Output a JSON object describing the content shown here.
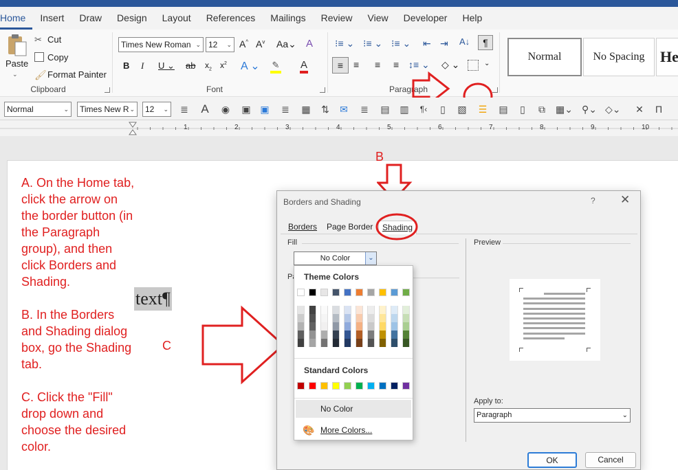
{
  "ribbon": {
    "tabs": [
      "Home",
      "Insert",
      "Draw",
      "Design",
      "Layout",
      "References",
      "Mailings",
      "Review",
      "View",
      "Developer",
      "Help"
    ],
    "active_tab": "Home",
    "clipboard": {
      "paste": "Paste",
      "cut": "Cut",
      "copy": "Copy",
      "format_painter": "Format Painter",
      "label": "Clipboard"
    },
    "font": {
      "name": "Times New Roman",
      "size": "12",
      "label": "Font"
    },
    "paragraph": {
      "label": "Paragraph"
    },
    "styles": {
      "normal": "Normal",
      "no_spacing": "No Spacing",
      "heading": "He"
    }
  },
  "qat": {
    "style": "Normal",
    "font": "Times New R",
    "size": "12"
  },
  "ruler": {
    "numbers": [
      "1",
      "2",
      "3",
      "4",
      "5",
      "6",
      "7",
      "8",
      "9",
      "10"
    ]
  },
  "document": {
    "instructions_a": [
      "A. On the Home tab,",
      "click the arrow on",
      "the border button (in",
      "the Paragraph",
      "group), and then",
      "click Borders and",
      "Shading."
    ],
    "instructions_b": [
      "B. In the Borders",
      "and Shading dialog",
      "box, go the Shading",
      "tab."
    ],
    "instructions_c": [
      "C. Click the \"Fill\"",
      "drop down and",
      "choose the desired",
      "color."
    ],
    "sample_text": "text¶",
    "label_b": "B",
    "label_c": "C"
  },
  "dialog": {
    "title": "Borders and Shading",
    "help": "?",
    "tabs": [
      "Borders",
      "Page Border",
      "Shading"
    ],
    "fill_label": "Fill",
    "fill_value": "No Color",
    "pattern_label_fragment": "Pa",
    "preview_label": "Preview",
    "apply_to_label": "Apply to:",
    "apply_to_value": "Paragraph",
    "ok": "OK",
    "cancel": "Cancel"
  },
  "palette": {
    "theme_title": "Theme Colors",
    "standard_title": "Standard Colors",
    "no_color": "No Color",
    "more_colors": "More Colors...",
    "theme_colors": [
      "#ffffff",
      "#000000",
      "#e7e6e6",
      "#44546a",
      "#4472c4",
      "#ed7d31",
      "#a5a5a5",
      "#ffc000",
      "#5b9bd5",
      "#70ad47"
    ],
    "standard_colors": [
      "#c00000",
      "#ff0000",
      "#ffc000",
      "#ffff00",
      "#92d050",
      "#00b050",
      "#00b0f0",
      "#0070c0",
      "#002060",
      "#7030a0"
    ]
  },
  "colors": {
    "accent": "#2b579a",
    "annotation": "#e02020"
  }
}
